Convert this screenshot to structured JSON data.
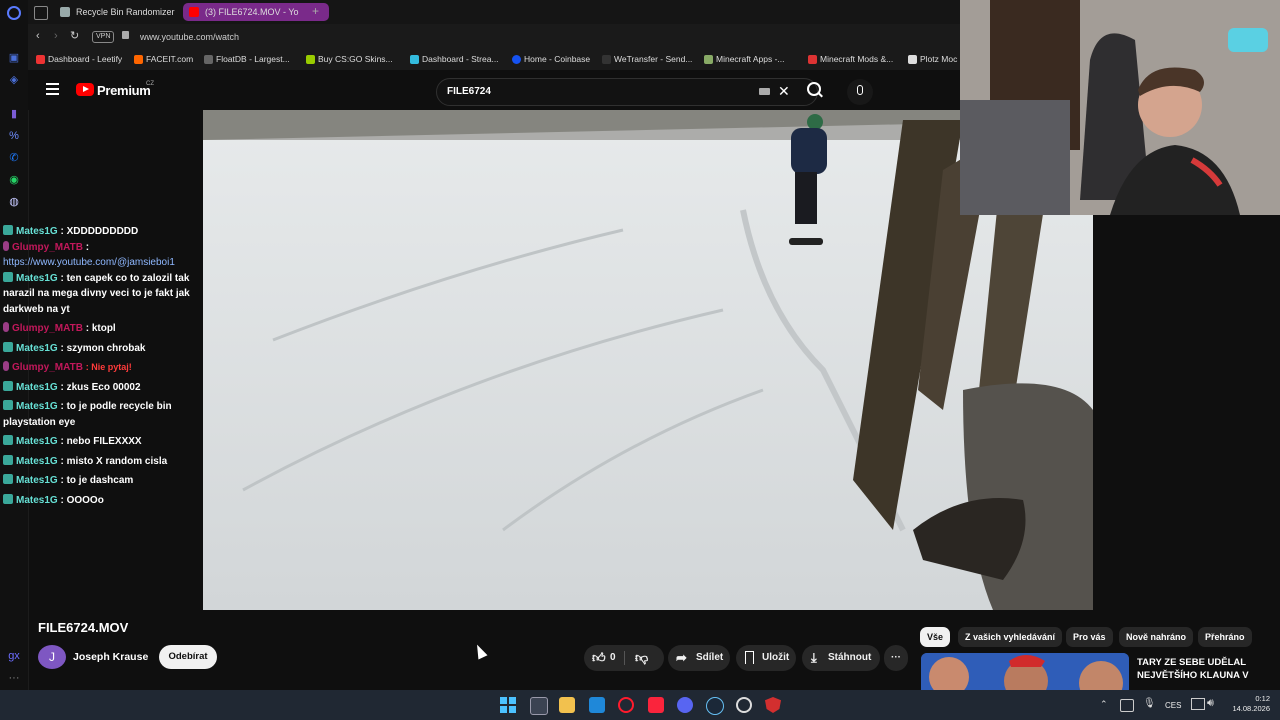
{
  "browser": {
    "tabs": [
      {
        "label": "Recycle Bin Randomizer",
        "active": false
      },
      {
        "label": "(3) FILE6724.MOV - Yo",
        "active": true
      }
    ],
    "new_tab_glyph": "+",
    "vpn_label": "VPN",
    "url": "www.youtube.com/watch",
    "bookmarks": [
      "Dashboard - Leetify",
      "FACEIT.com",
      "FloatDB - Largest...",
      "Buy CS:GO Skins...",
      "Dashboard - Strea...",
      "Home - Coinbase",
      "WeTransfer - Send...",
      "Minecraft Apps -...",
      "Minecraft Mods &...",
      "Plotz Moc"
    ]
  },
  "youtube": {
    "logo_text": "Premium",
    "logo_region": "CZ",
    "search_query": "FILE6724",
    "video_title": "FILE6724.MOV",
    "channel_avatar_letter": "J",
    "channel_name": "Joseph Krause",
    "subscribe_label": "Odebírat",
    "like_count": "0",
    "share_label": "Sdílet",
    "save_label": "Uložit",
    "download_label": "Stáhnout",
    "more_glyph": "···",
    "filter_chips": [
      "Vše",
      "Z vašich vyhledávání",
      "Pro vás",
      "Nově nahráno",
      "Přehráno"
    ],
    "recommended_title": "TARY ZE SEBE UDĚLAL NEJVĚTŠÍHO KLAUNA V"
  },
  "chat": [
    {
      "user": "Mates1G",
      "color": "teal",
      "msg": ": XDDDDDDDDD"
    },
    {
      "user": "Glumpy_MATB",
      "color": "red",
      "msg": ":"
    },
    {
      "user": "",
      "color": "link",
      "msg": "https://www.youtube.com/@jamsieboi1"
    },
    {
      "user": "Mates1G",
      "color": "teal",
      "msg": ": ten capek co to zalozil tak narazil na mega divny veci to je fakt jak darkweb na yt"
    },
    {
      "user": "Glumpy_MATB",
      "color": "red",
      "msg": ": ktopl"
    },
    {
      "user": "Mates1G",
      "color": "teal",
      "msg": ": szymon chrobak"
    },
    {
      "user": "Glumpy_MATB",
      "color": "red",
      "msg": ": Nie pytaj!"
    },
    {
      "user": "Mates1G",
      "color": "teal",
      "msg": ": zkus Eco 00002"
    },
    {
      "user": "Mates1G",
      "color": "teal",
      "msg": ": to je podle recycle bin playstation eye"
    },
    {
      "user": "Mates1G",
      "color": "teal",
      "msg": ": nebo FILEXXXX"
    },
    {
      "user": "Mates1G",
      "color": "teal",
      "msg": ": misto X random cisla"
    },
    {
      "user": "Mates1G",
      "color": "teal",
      "msg": ": to je dashcam"
    },
    {
      "user": "Mates1G",
      "color": "teal",
      "msg": ": OOOOo"
    }
  ],
  "taskbar": {
    "lang": "CES",
    "time": "0:12",
    "date": "14.08.2026"
  },
  "colors": {
    "youtube_red": "#ff0000",
    "chat_teal": "#67e0d5",
    "chat_red": "#c2185b",
    "active_tab": "#7a2a8a"
  }
}
